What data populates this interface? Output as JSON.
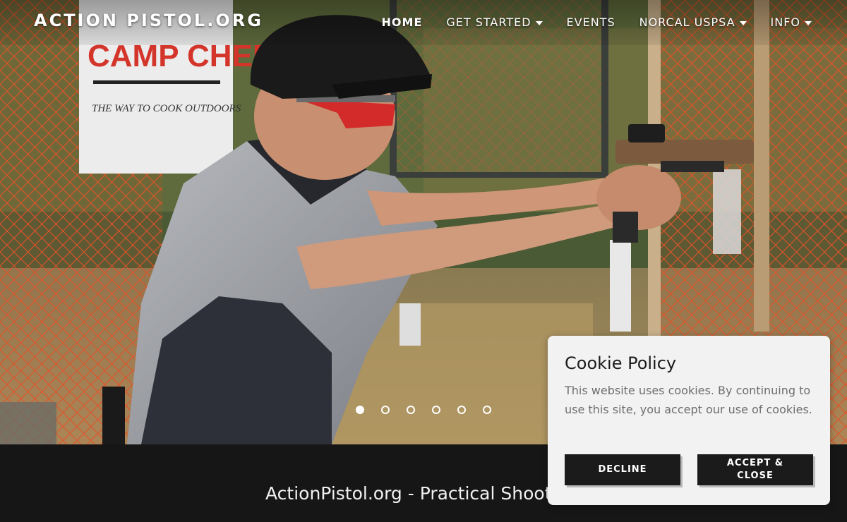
{
  "site": {
    "logo_text": "ACTION PISTOL.ORG"
  },
  "nav": {
    "items": [
      {
        "label": "HOME",
        "active": true,
        "has_dropdown": false
      },
      {
        "label": "GET STARTED",
        "active": false,
        "has_dropdown": true
      },
      {
        "label": "EVENTS",
        "active": false,
        "has_dropdown": false
      },
      {
        "label": "NORCAL USPSA",
        "active": false,
        "has_dropdown": true
      },
      {
        "label": "INFO",
        "active": false,
        "has_dropdown": true
      }
    ]
  },
  "hero": {
    "banner_text": "CAMP CHEF",
    "banner_subtext": "THE WAY TO COOK OUTDOORS",
    "slide_count": 6,
    "active_slide": 1
  },
  "tagline": {
    "text": "ActionPistol.org - Practical Shoot"
  },
  "cookie": {
    "title": "Cookie Policy",
    "body": "This website uses cookies. By continuing to use this site, you accept our use of cookies.",
    "decline_label": "DECLINE",
    "accept_label": "ACCEPT & CLOSE"
  },
  "colors": {
    "band_bg": "#161616",
    "card_bg": "#f2f2f2",
    "button_bg": "#1b1b1b",
    "fence_orange": "#e2542a"
  }
}
